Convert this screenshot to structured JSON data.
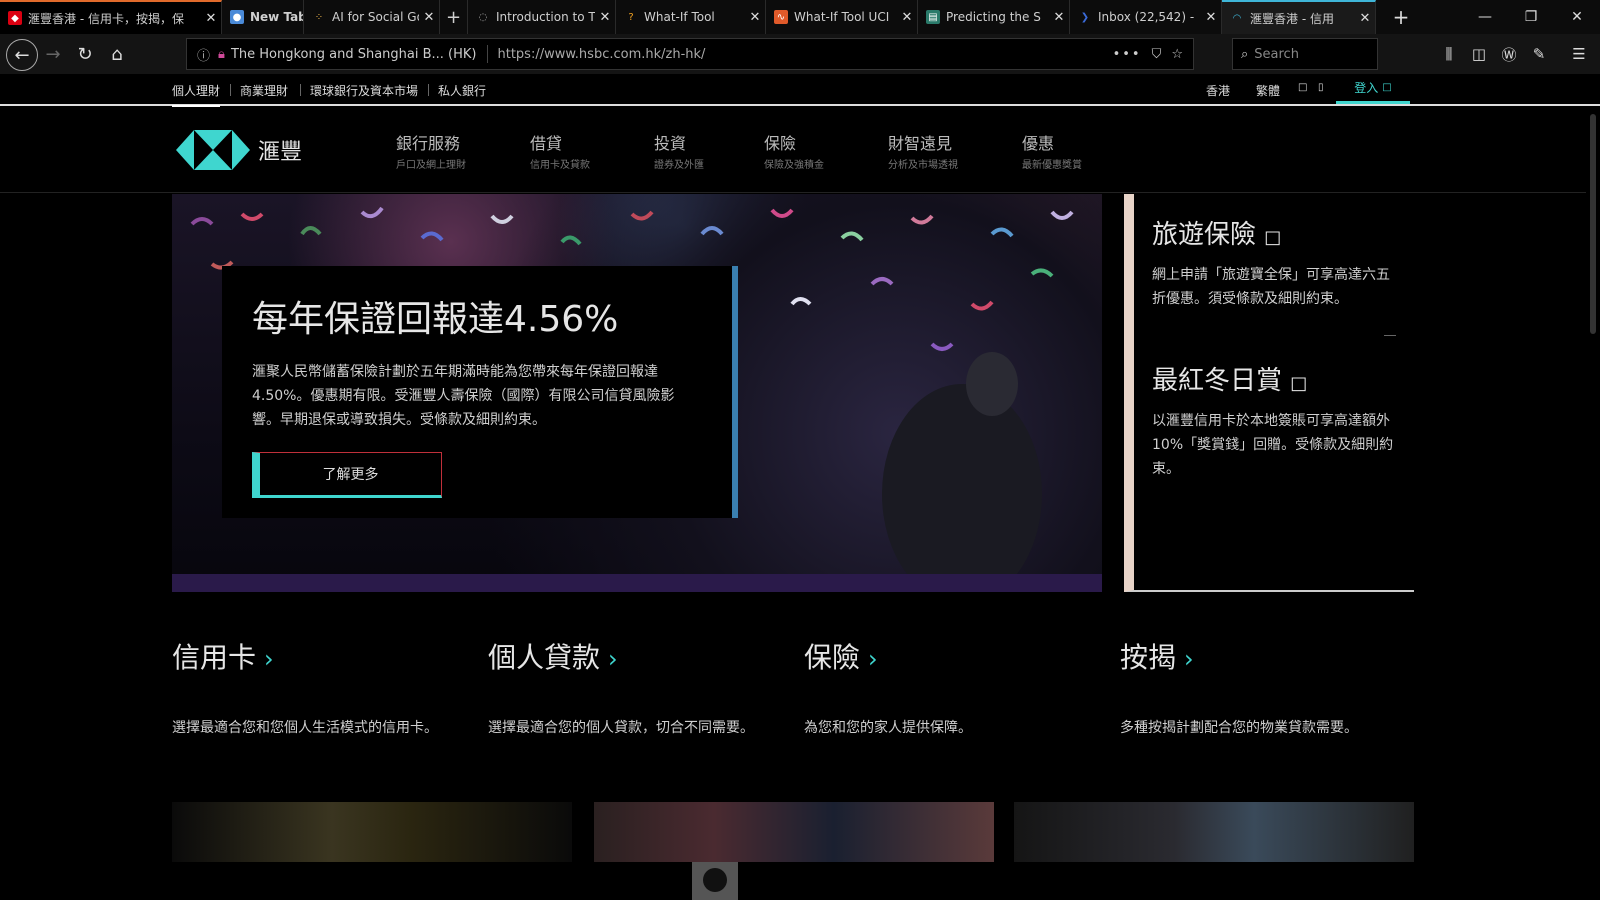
{
  "browser": {
    "tabs": [
      {
        "label": "滙豐香港 - 信用卡，按揭，保",
        "close": "✕"
      },
      {
        "label": "New Tab",
        "close": ""
      },
      {
        "label": "AI for Social Go",
        "close": "✕"
      },
      {
        "label": "Introduction to T",
        "close": "✕"
      },
      {
        "label": "What-If Tool",
        "close": "✕"
      },
      {
        "label": "What-If Tool UCI",
        "close": "✕"
      },
      {
        "label": "Predicting the S",
        "close": "✕"
      },
      {
        "label": "Inbox (22,542) -",
        "close": "✕"
      },
      {
        "label": "滙豐香港 - 信用",
        "close": "✕"
      }
    ],
    "url_identity": "The Hongkong and Shanghai B... (HK)",
    "url": "https://www.hsbc.com.hk/zh-hk/",
    "search_placeholder": "Search",
    "new_tab": "+"
  },
  "site": {
    "topnav": [
      "個人理財",
      "商業理財",
      "環球銀行及資本市場",
      "私人銀行"
    ],
    "region": "香港",
    "language": "繁體",
    "login": "登入",
    "brand": "滙豐",
    "mainnav": [
      {
        "title": "銀行服務",
        "sub": "戶口及網上理財"
      },
      {
        "title": "借貸",
        "sub": "信用卡及貸款"
      },
      {
        "title": "投資",
        "sub": "證券及外匯"
      },
      {
        "title": "保險",
        "sub": "保險及強積金"
      },
      {
        "title": "財智遠見",
        "sub": "分析及市場透視"
      },
      {
        "title": "優惠",
        "sub": "最新優惠獎賞"
      }
    ],
    "hero": {
      "title": "每年保證回報達4.56%",
      "body": "滙聚人民幣儲蓄保險計劃於五年期滿時能為您帶來每年保證回報達4.50%。優惠期有限。受滙豐人壽保險（國際）有限公司信貸風險影響。早期退保或導致損失。受條款及細則約束。",
      "button": "了解更多"
    },
    "side": [
      {
        "title": "旅遊保險",
        "body": "網上申請「旅遊寶全保」可享高達六五折優惠。須受條款及細則約束。"
      },
      {
        "title": "最紅冬日賞",
        "body": "以滙豐信用卡於本地簽賬可享高達額外10%「獎賞錢」回贈。受條款及細則約束。"
      }
    ],
    "categories": [
      {
        "title": "信用卡",
        "body": "選擇最適合您和您個人生活模式的信用卡。"
      },
      {
        "title": "個人貸款",
        "body": "選擇最適合您的個人貸款，切合不同需要。"
      },
      {
        "title": "保險",
        "body": "為您和您的家人提供保障。"
      },
      {
        "title": "按揭",
        "body": "多種按揭計劃配合您的物業貸款需要。"
      }
    ]
  },
  "colors": {
    "accent": "#3fd6cf",
    "brand_red": "#db0011",
    "tab_active": "#3fb6d8"
  }
}
